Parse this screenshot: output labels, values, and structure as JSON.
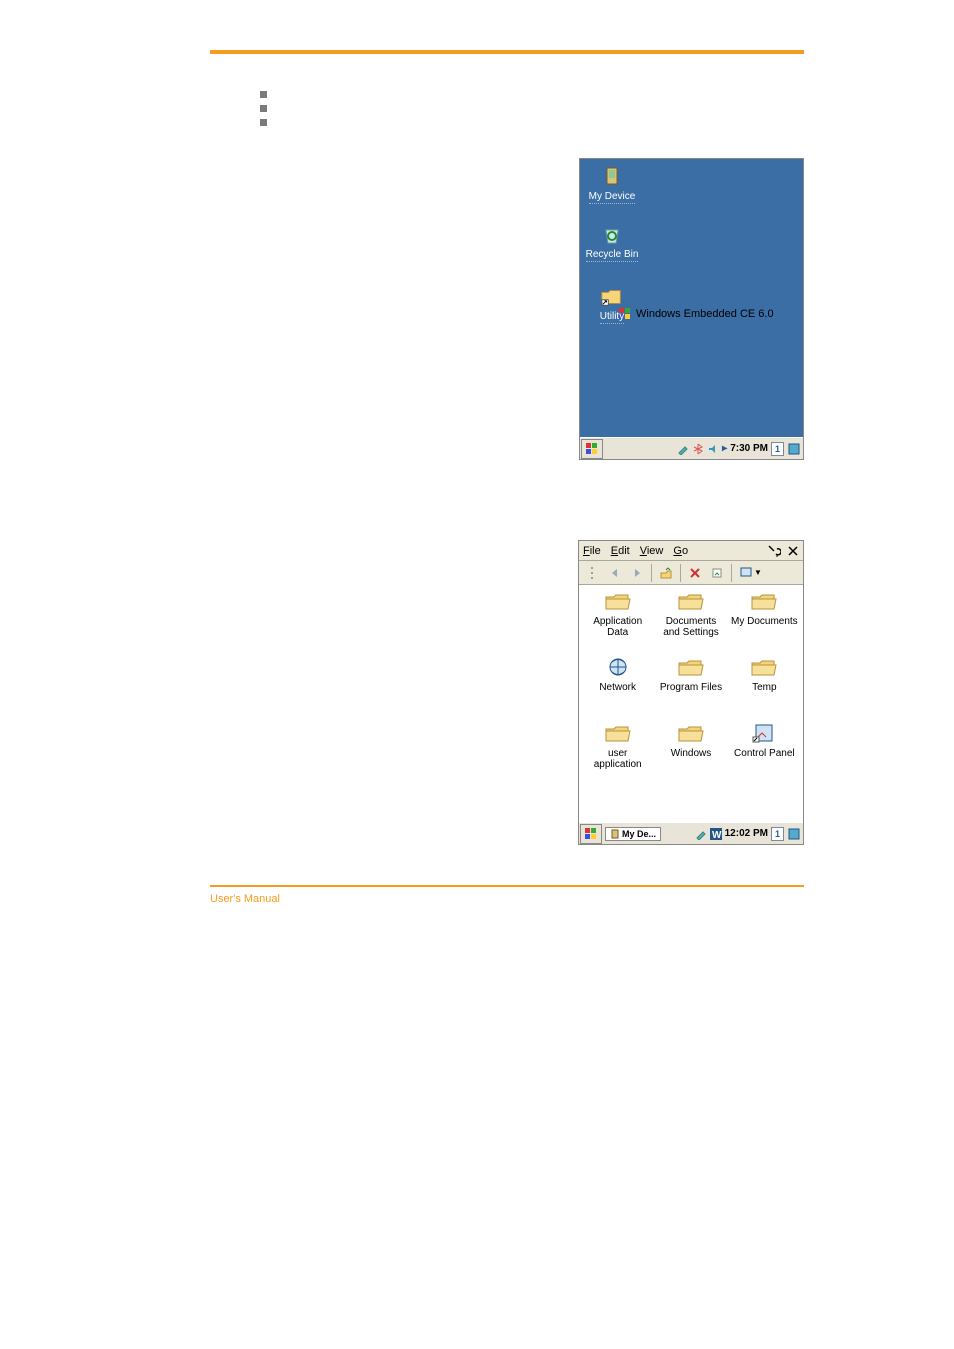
{
  "bullets": [
    "",
    "",
    ""
  ],
  "desktop": {
    "icons": [
      {
        "name": "my-device-icon",
        "label": "My Device"
      },
      {
        "name": "recycle-bin-icon",
        "label": "Recycle Bin"
      },
      {
        "name": "utility-icon",
        "label": "Utility"
      }
    ],
    "wince_text": "Windows Embedded CE 6.0",
    "taskbar": {
      "time": "7:30 PM",
      "indicator": "1"
    }
  },
  "explorer": {
    "menu": {
      "file": "File",
      "edit": "Edit",
      "view": "View",
      "go": "Go"
    },
    "folders": [
      {
        "name": "application-data-folder",
        "label": "Application Data"
      },
      {
        "name": "documents-settings-folder",
        "label": "Documents and Settings"
      },
      {
        "name": "my-documents-folder",
        "label": "My Documents"
      },
      {
        "name": "network-folder",
        "label": "Network"
      },
      {
        "name": "program-files-folder",
        "label": "Program Files"
      },
      {
        "name": "temp-folder",
        "label": "Temp"
      },
      {
        "name": "user-application-folder",
        "label": "user application"
      },
      {
        "name": "windows-folder",
        "label": "Windows"
      },
      {
        "name": "control-panel-item",
        "label": "Control Panel"
      }
    ],
    "taskbar": {
      "task": "My De...",
      "time": "12:02 PM",
      "indicator": "1"
    }
  },
  "footer": {
    "left": "User's Manual",
    "right": ""
  }
}
